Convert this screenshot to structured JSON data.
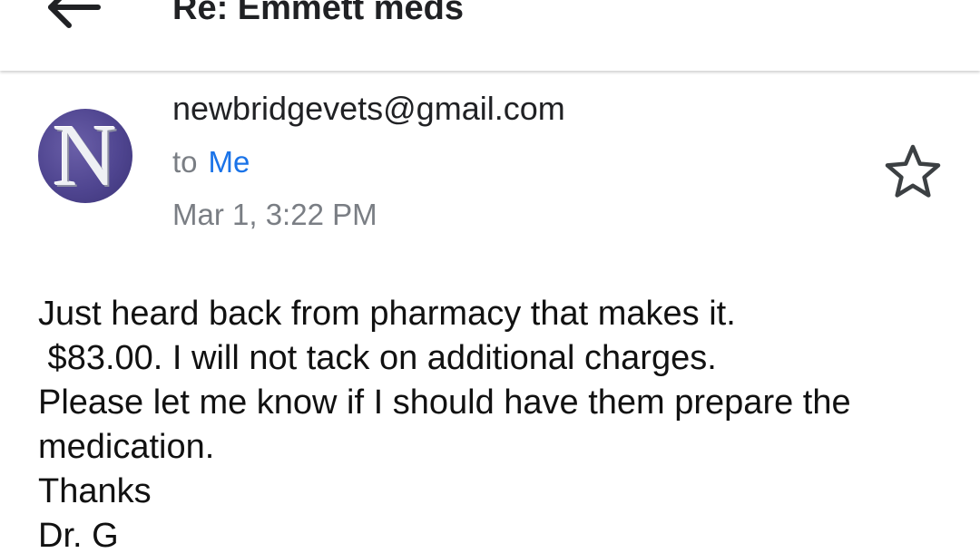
{
  "header": {
    "subject": "Re: Emmett meds",
    "back_icon": "arrow-left-icon"
  },
  "message": {
    "avatar_letter": "N",
    "sender": "newbridgevets@gmail.com",
    "to_label": "to",
    "to_name": "Me",
    "date": "Mar 1, 3:22 PM",
    "star_icon": "star-outline-icon",
    "body_lines": [
      "Just heard back from pharmacy that makes it.",
      " $83.00. I will not tack on additional charges.",
      "Please let me know if I should have them prepare the",
      "medication.",
      "Thanks",
      "Dr. G"
    ]
  },
  "colors": {
    "link": "#1a73e8",
    "secondary_text": "#7a7e84",
    "avatar_bg": "#4f4590"
  }
}
